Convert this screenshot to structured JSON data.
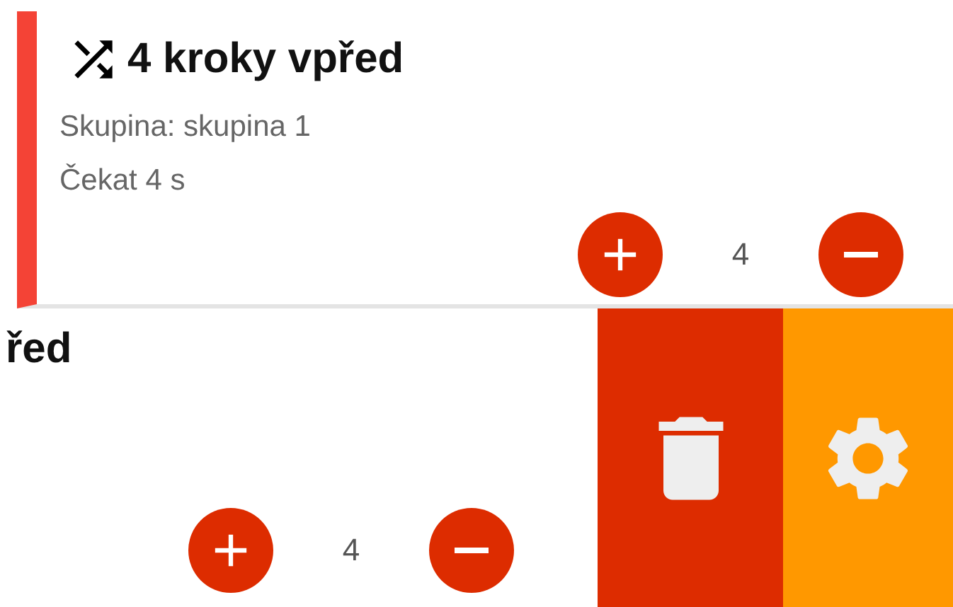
{
  "cards": [
    {
      "title": "4 kroky vpřed",
      "lines": [
        "Skupina: skupina 1",
        "Čekat 4 s"
      ],
      "count": "4"
    },
    {
      "title": "řed",
      "count": "4"
    }
  ],
  "actions": [
    {
      "kind": "delete"
    },
    {
      "kind": "settings"
    }
  ]
}
